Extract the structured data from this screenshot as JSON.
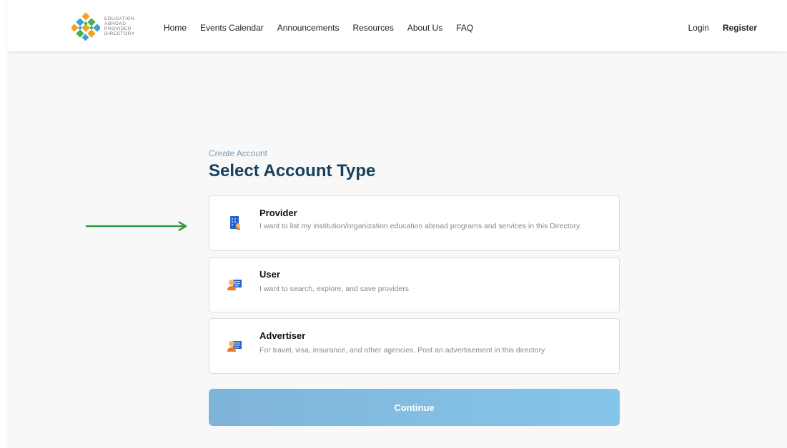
{
  "brand": {
    "logo_lines": [
      "EDUCATION",
      "ABROAD",
      "PROVIDER",
      "DIRECTORY"
    ],
    "colors": [
      "#f4a21d",
      "#3aa0d8",
      "#4cae4c"
    ]
  },
  "nav": {
    "items": [
      "Home",
      "Events Calendar",
      "Announcements",
      "Resources",
      "About Us",
      "FAQ"
    ],
    "login": "Login",
    "register": "Register"
  },
  "main": {
    "eyebrow": "Create Account",
    "title": "Select Account Type",
    "options": [
      {
        "title": "Provider",
        "description": "I want to list my institution/organization education abroad programs and services in this Directory.",
        "icon": "building-icon"
      },
      {
        "title": "User",
        "description": "I want to search, explore, and save providers",
        "icon": "user-card-icon"
      },
      {
        "title": "Advertiser",
        "description": "For travel, visa, insurance, and other agencies. Post an advertisement in this directory.",
        "icon": "user-card-icon"
      }
    ],
    "continue_label": "Continue"
  },
  "annotation": {
    "arrow_color": "#2e9b47"
  }
}
